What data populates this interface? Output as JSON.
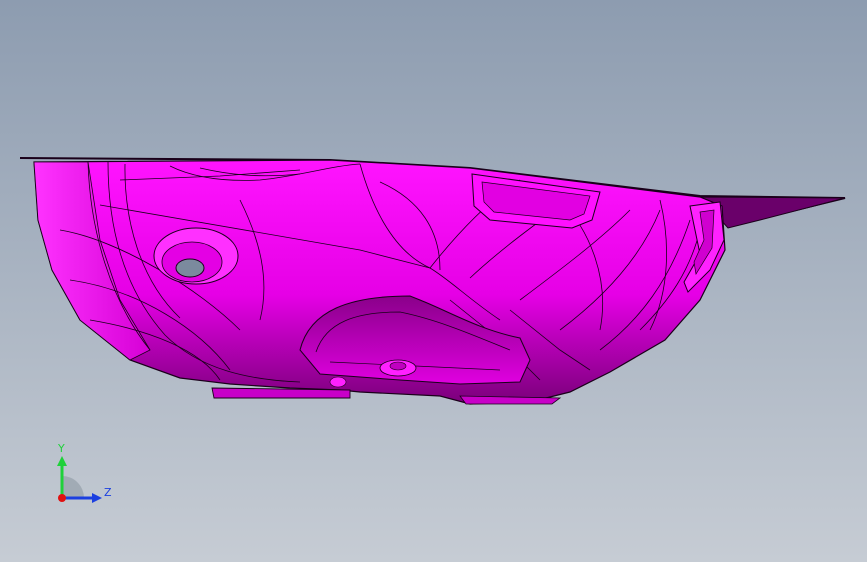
{
  "viewport": {
    "background_top": "#8d9cb0",
    "background_bottom": "#c6ccd4"
  },
  "model": {
    "face_color": "#ff00ff",
    "edge_color": "#1a001a"
  },
  "triad": {
    "y_label": "Y",
    "z_label": "Z",
    "y_color": "#1fd13a",
    "z_color": "#1b3fe0",
    "x_color": "#e01010"
  }
}
